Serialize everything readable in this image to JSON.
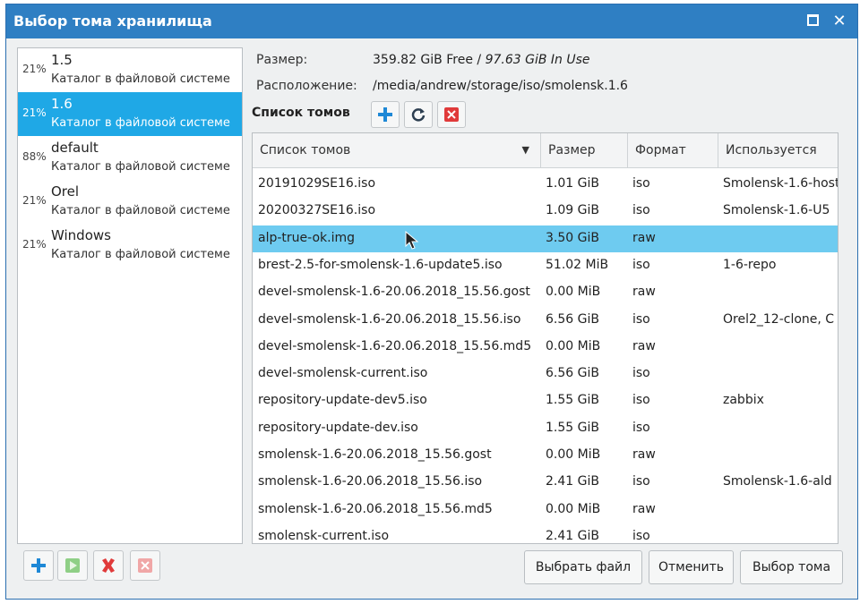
{
  "window": {
    "title": "Выбор тома хранилища"
  },
  "pools": [
    {
      "percent": "21%",
      "name": "1.5",
      "description": "Каталог в файловой системе"
    },
    {
      "percent": "21%",
      "name": "1.6",
      "description": "Каталог в файловой системе",
      "selected": true
    },
    {
      "percent": "88%",
      "name": "default",
      "description": "Каталог в файловой системе"
    },
    {
      "percent": "21%",
      "name": "Orel",
      "description": "Каталог в файловой системе"
    },
    {
      "percent": "21%",
      "name": "Windows",
      "description": "Каталог в файловой системе"
    }
  ],
  "info": {
    "size_label": "Размер:",
    "size_free": "359.82 GiB Free",
    "size_sep": " / ",
    "size_used": "97.63 GiB In Use",
    "location_label": "Расположение:",
    "location_value": "/media/andrew/storage/iso/smolensk.1.6"
  },
  "volumes_header": "Список томов",
  "table": {
    "columns": [
      "Список томов",
      "Размер",
      "Формат",
      "Используется"
    ],
    "rows": [
      {
        "name": "20191029SE16.iso",
        "size": "1.01 GiB",
        "format": "iso",
        "used": "Smolensk-1.6-host"
      },
      {
        "name": "20200327SE16.iso",
        "size": "1.09 GiB",
        "format": "iso",
        "used": "Smolensk-1.6-U5"
      },
      {
        "name": "alp-true-ok.img",
        "size": "3.50 GiB",
        "format": "raw",
        "used": "",
        "selected": true
      },
      {
        "name": "brest-2.5-for-smolensk-1.6-update5.iso",
        "size": "51.02 MiB",
        "format": "iso",
        "used": "1-6-repo"
      },
      {
        "name": "devel-smolensk-1.6-20.06.2018_15.56.gost",
        "size": "0.00 MiB",
        "format": "raw",
        "used": ""
      },
      {
        "name": "devel-smolensk-1.6-20.06.2018_15.56.iso",
        "size": "6.56 GiB",
        "format": "iso",
        "used": "Orel2_12-clone, C"
      },
      {
        "name": "devel-smolensk-1.6-20.06.2018_15.56.md5",
        "size": "0.00 MiB",
        "format": "raw",
        "used": ""
      },
      {
        "name": "devel-smolensk-current.iso",
        "size": "6.56 GiB",
        "format": "iso",
        "used": ""
      },
      {
        "name": "repository-update-dev5.iso",
        "size": "1.55 GiB",
        "format": "iso",
        "used": "zabbix"
      },
      {
        "name": "repository-update-dev.iso",
        "size": "1.55 GiB",
        "format": "iso",
        "used": ""
      },
      {
        "name": "smolensk-1.6-20.06.2018_15.56.gost",
        "size": "0.00 MiB",
        "format": "raw",
        "used": ""
      },
      {
        "name": "smolensk-1.6-20.06.2018_15.56.iso",
        "size": "2.41 GiB",
        "format": "iso",
        "used": "Smolensk-1.6-ald"
      },
      {
        "name": "smolensk-1.6-20.06.2018_15.56.md5",
        "size": "0.00 MiB",
        "format": "raw",
        "used": ""
      },
      {
        "name": "smolensk-current.iso",
        "size": "2.41 GiB",
        "format": "iso",
        "used": ""
      }
    ]
  },
  "buttons": {
    "browse": "Выбрать файл",
    "cancel": "Отменить",
    "choose": "Выбор тома"
  },
  "colors": {
    "titlebar": "#2f7fc3",
    "selection_pool": "#1fa8e6",
    "selection_row": "#6ecbf0",
    "add": "#1e88d6",
    "delete": "#e03a3a"
  }
}
